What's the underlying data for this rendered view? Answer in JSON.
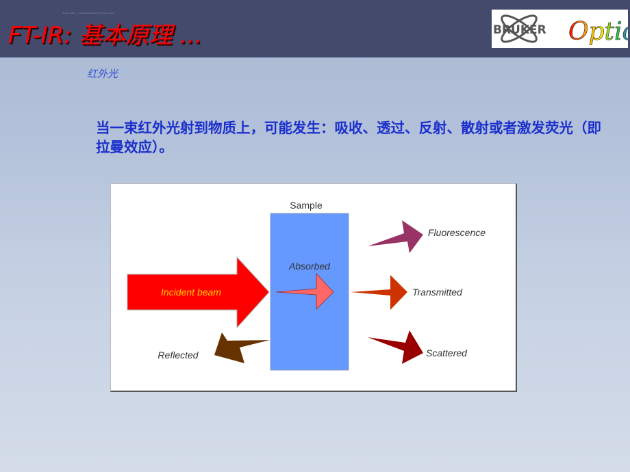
{
  "header": {
    "fineprint": "Bruker Optics — Infrared Spectroscopy Training Course",
    "title": "FT-IR: 基本原理 ...",
    "logo": {
      "brand": "BRUKER",
      "script": "Optics"
    }
  },
  "subtitle": "红外光",
  "body_text": "当一束红外光射到物质上，可能发生：吸收、透过、反射、散射或者激发荧光（即拉曼效应）。",
  "diagram": {
    "sample_label": "Sample",
    "absorbed_label": "Absorbed",
    "incident_label": "Incident beam",
    "reflected_label": "Reflected",
    "fluorescence_label": "Fluorescence",
    "transmitted_label": "Transmitted",
    "scattered_label": "Scattered",
    "colors": {
      "sample": "#6699ff",
      "incident": "#ff0000",
      "incident_text": "#ffcc00",
      "absorbed": "#ff6666",
      "reflected": "#663300",
      "fluorescence": "#993366",
      "transmitted": "#cc3300",
      "scattered": "#990000"
    }
  }
}
